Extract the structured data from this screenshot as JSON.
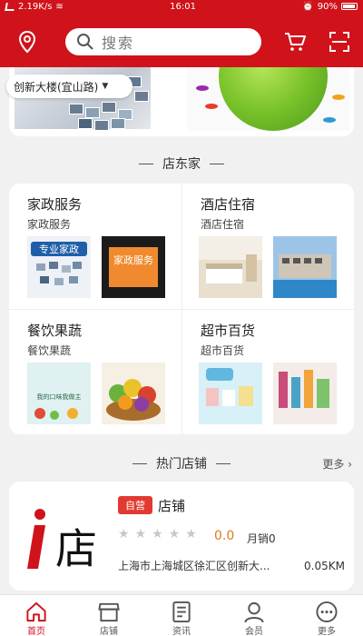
{
  "status_bar": {
    "speed": "2.19K/s",
    "time": "16:01",
    "battery": "90%"
  },
  "header": {
    "search_placeholder": "搜索"
  },
  "location": {
    "text": "创新大楼(宜山路)"
  },
  "section_title": "店东家",
  "categories": [
    {
      "title": "家政服务",
      "subtitle": "家政服务",
      "img1_text": "专业家政",
      "img2_text": "家政服务"
    },
    {
      "title": "酒店住宿",
      "subtitle": "酒店住宿"
    },
    {
      "title": "餐饮果蔬",
      "subtitle": "餐饮果蔬",
      "img1_text": "我的口味我做主"
    },
    {
      "title": "超市百货",
      "subtitle": "超市百货"
    }
  ],
  "hot_shops": {
    "title": "热门店铺",
    "more": "更多",
    "shop": {
      "badge": "自营",
      "name": "店铺",
      "rating": "0.0",
      "monthly_sales": "月销0",
      "address": "上海市上海城区徐汇区创新大...",
      "distance": "0.05KM",
      "logo_text": "店"
    }
  },
  "nav": [
    {
      "label": "首页",
      "icon": "home-icon",
      "active": true
    },
    {
      "label": "店铺",
      "icon": "store-icon",
      "active": false
    },
    {
      "label": "资讯",
      "icon": "news-icon",
      "active": false
    },
    {
      "label": "会员",
      "icon": "member-icon",
      "active": false
    },
    {
      "label": "更多",
      "icon": "more-icon",
      "active": false
    }
  ],
  "colors": {
    "brand": "#d0121b",
    "accent": "#e23a31",
    "rating": "#e07a13"
  }
}
